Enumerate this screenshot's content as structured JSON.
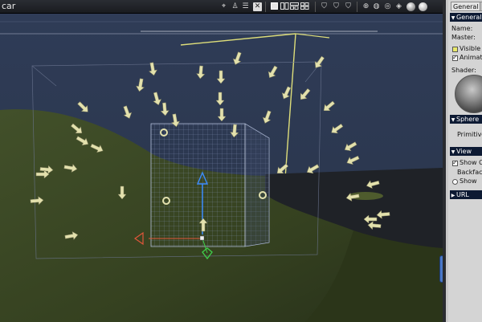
{
  "window": {
    "title": "car"
  },
  "toolbar": {
    "icons": [
      "camera-icon",
      "light-icon",
      "move-icon",
      "select-icon",
      "single-view-icon",
      "two-view-icon",
      "three-view-icon",
      "four-view-icon",
      "shield-a-icon",
      "shield-b-icon",
      "shield-c-icon",
      "axis-icon",
      "globe-icon",
      "target-icon",
      "cube-icon",
      "sphere-shaded-icon",
      "sphere-smooth-icon"
    ]
  },
  "panel": {
    "tabs": [
      "General",
      "M"
    ],
    "general_header": "General",
    "name_label": "Name:",
    "master_label": "Master:",
    "visible_label": "Visible",
    "animated_label": "Animated",
    "shader_label": "Shader:",
    "sphere_header": "Sphere",
    "primitive_label": "Primitive S",
    "view_header": "View",
    "show_obj_label": "Show Ob",
    "backfaces_label": "Backfaces",
    "show_label": "Show",
    "url_header": "URL"
  },
  "colors": {
    "accent": "#0d1a33",
    "sky": "#2d3a54",
    "ground": "#3c4822",
    "arrows": "#e8e6b0"
  }
}
